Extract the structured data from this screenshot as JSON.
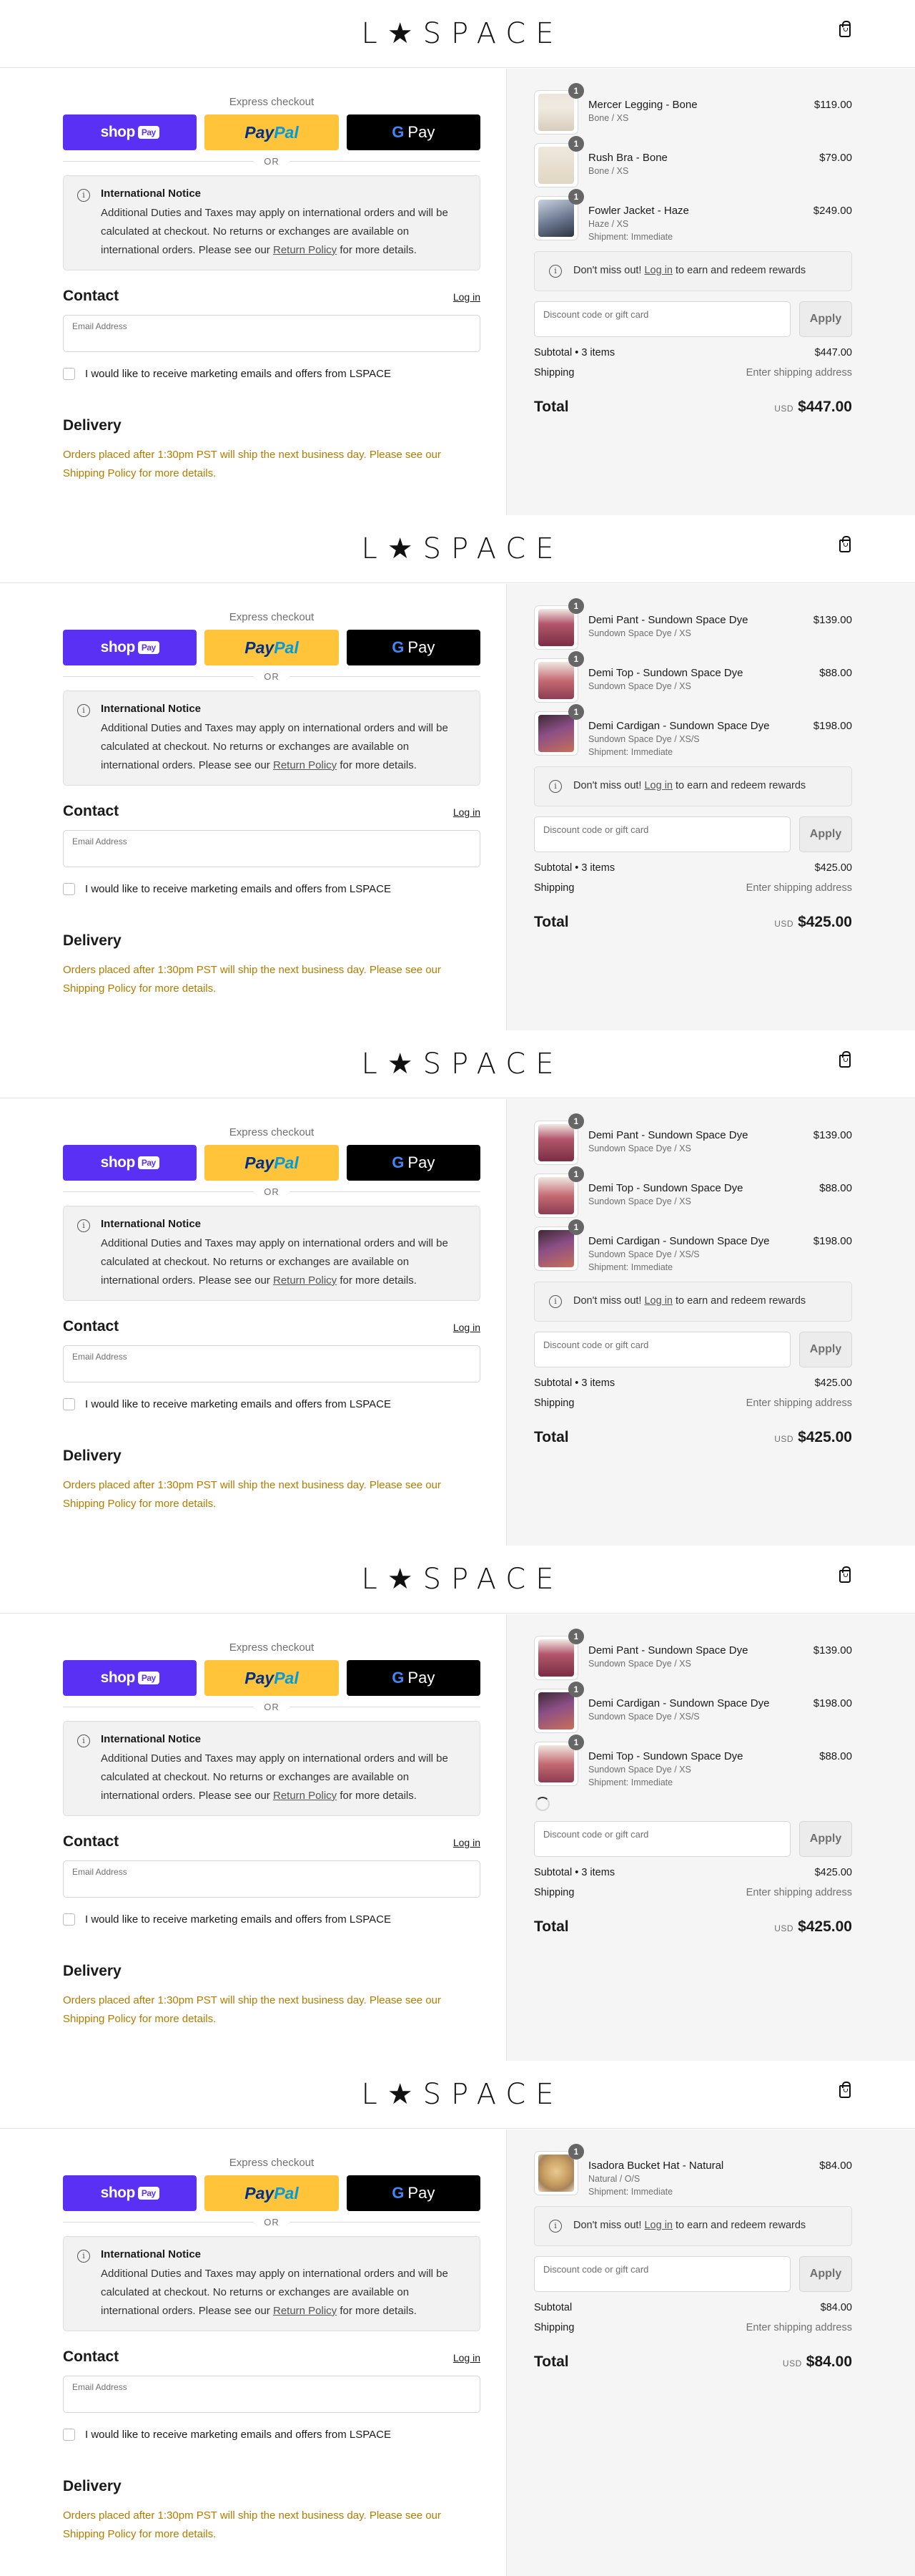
{
  "header": {
    "logo": "L★SPACE"
  },
  "checkout": {
    "express_title": "Express checkout",
    "shop_label": "shop",
    "shop_pay_tag": "Pay",
    "paypal_part1": "Pay",
    "paypal_part2": "Pal",
    "gpay_g": "G",
    "gpay_label": "Pay",
    "or_label": "OR",
    "notice_title": "International Notice",
    "notice_body_pre": "Additional Duties and Taxes may apply on international orders and will be calculated at checkout. No returns or exchanges are available on international orders. Please see our ",
    "notice_link": "Return Policy",
    "notice_body_post": " for more details.",
    "contact_title": "Contact",
    "login_label": "Log in",
    "email_label": "Email Address",
    "email_value": "",
    "marketing_label": "I would like to receive marketing emails and offers from LSPACE",
    "delivery_title": "Delivery",
    "delivery_note": "Orders placed after 1:30pm PST will ship the next business day. Please see our Shipping Policy for more details."
  },
  "summary_common": {
    "rewards_pre": "Don't miss out! ",
    "rewards_link": "Log in",
    "rewards_post": " to earn and redeem rewards",
    "discount_placeholder": "Discount code or gift card",
    "apply_label": "Apply",
    "shipping_label": "Shipping",
    "shipping_value": "Enter shipping address",
    "total_label": "Total",
    "currency": "USD"
  },
  "panels": [
    {
      "items": [
        {
          "name": "Mercer Legging - Bone",
          "variant": "Bone / XS",
          "extra": "",
          "price": "$119.00",
          "qty": "1",
          "image": "cream"
        },
        {
          "name": "Rush Bra - Bone",
          "variant": "Bone / XS",
          "extra": "",
          "price": "$79.00",
          "qty": "1",
          "image": "cream2"
        },
        {
          "name": "Fowler Jacket - Haze",
          "variant": "Haze / XS",
          "extra": "Shipment: Immediate",
          "price": "$249.00",
          "qty": "1",
          "image": "jacket"
        }
      ],
      "show_rewards": true,
      "show_spinner": false,
      "subtotal_label": "Subtotal • 3 items",
      "subtotal": "$447.00",
      "total": "$447.00"
    },
    {
      "items": [
        {
          "name": "Demi Pant - Sundown Space Dye",
          "variant": "Sundown Space Dye / XS",
          "extra": "",
          "price": "$139.00",
          "qty": "1",
          "image": "sun-pant"
        },
        {
          "name": "Demi Top - Sundown Space Dye",
          "variant": "Sundown Space Dye / XS",
          "extra": "",
          "price": "$88.00",
          "qty": "1",
          "image": "sun-top"
        },
        {
          "name": "Demi Cardigan - Sundown Space Dye",
          "variant": "Sundown Space Dye / XS/S",
          "extra": "Shipment: Immediate",
          "price": "$198.00",
          "qty": "1",
          "image": "sun-card"
        }
      ],
      "show_rewards": true,
      "show_spinner": false,
      "subtotal_label": "Subtotal • 3 items",
      "subtotal": "$425.00",
      "total": "$425.00"
    },
    {
      "items": [
        {
          "name": "Demi Pant - Sundown Space Dye",
          "variant": "Sundown Space Dye / XS",
          "extra": "",
          "price": "$139.00",
          "qty": "1",
          "image": "sun-pant"
        },
        {
          "name": "Demi Top - Sundown Space Dye",
          "variant": "Sundown Space Dye / XS",
          "extra": "",
          "price": "$88.00",
          "qty": "1",
          "image": "sun-top"
        },
        {
          "name": "Demi Cardigan - Sundown Space Dye",
          "variant": "Sundown Space Dye / XS/S",
          "extra": "Shipment: Immediate",
          "price": "$198.00",
          "qty": "1",
          "image": "sun-card"
        }
      ],
      "show_rewards": true,
      "show_spinner": false,
      "subtotal_label": "Subtotal • 3 items",
      "subtotal": "$425.00",
      "total": "$425.00"
    },
    {
      "items": [
        {
          "name": "Demi Pant - Sundown Space Dye",
          "variant": "Sundown Space Dye / XS",
          "extra": "",
          "price": "$139.00",
          "qty": "1",
          "image": "sun-pant"
        },
        {
          "name": "Demi Cardigan - Sundown Space Dye",
          "variant": "Sundown Space Dye / XS/S",
          "extra": "",
          "price": "$198.00",
          "qty": "1",
          "image": "sun-card"
        },
        {
          "name": "Demi Top - Sundown Space Dye",
          "variant": "Sundown Space Dye / XS",
          "extra": "Shipment: Immediate",
          "price": "$88.00",
          "qty": "1",
          "image": "sun-top"
        }
      ],
      "show_rewards": false,
      "show_spinner": true,
      "subtotal_label": "Subtotal • 3 items",
      "subtotal": "$425.00",
      "total": "$425.00"
    },
    {
      "items": [
        {
          "name": "Isadora Bucket Hat - Natural",
          "variant": "Natural / O/S",
          "extra": "Shipment: Immediate",
          "price": "$84.00",
          "qty": "1",
          "image": "hat"
        }
      ],
      "show_rewards": true,
      "show_spinner": false,
      "subtotal_label": "Subtotal",
      "subtotal": "$84.00",
      "total": "$84.00"
    }
  ],
  "colors": {
    "shop_pay": "#5a31f4",
    "paypal": "#ffc439",
    "gpay": "#000000",
    "delivery_note": "#b27b00",
    "summary_bg": "#f5f5f5"
  }
}
